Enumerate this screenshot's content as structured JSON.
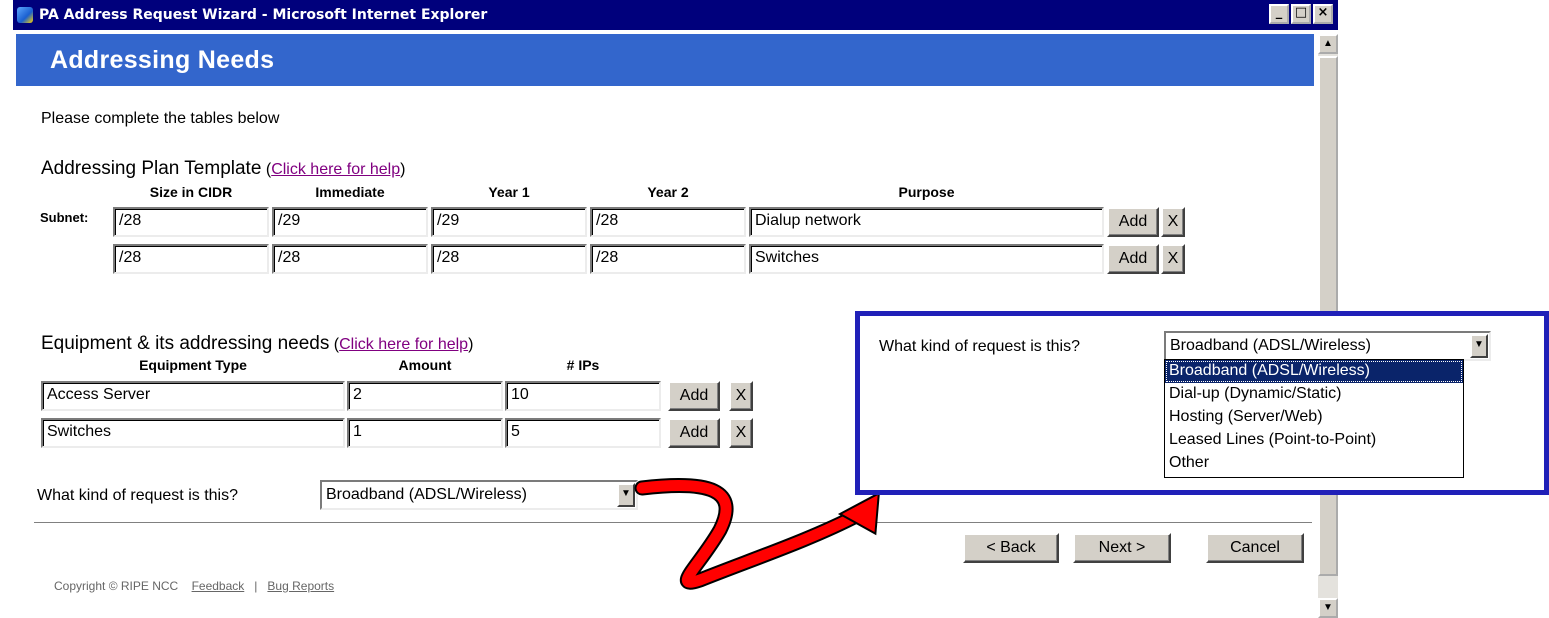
{
  "window": {
    "title": "PA Address Request Wizard - Microsoft Internet Explorer"
  },
  "page": {
    "heading": "Addressing Needs",
    "instruction": "Please complete the tables below"
  },
  "addressing_plan": {
    "title": "Addressing Plan Template",
    "help_link": "Click here for help",
    "row_label": "Subnet:",
    "columns": [
      "Size in CIDR",
      "Immediate",
      "Year 1",
      "Year 2",
      "Purpose"
    ],
    "rows": [
      {
        "size": "/28",
        "immediate": "/29",
        "year1": "/29",
        "year2": "/28",
        "purpose": "Dialup network"
      },
      {
        "size": "/28",
        "immediate": "/28",
        "year1": "/28",
        "year2": "/28",
        "purpose": "Switches"
      }
    ]
  },
  "equipment": {
    "title": "Equipment & its addressing needs",
    "help_link": "Click here for help",
    "columns": [
      "Equipment Type",
      "Amount",
      "# IPs"
    ],
    "rows": [
      {
        "type": "Access Server",
        "amount": "2",
        "ips": "10"
      },
      {
        "type": "Switches",
        "amount": "1",
        "ips": "5"
      }
    ]
  },
  "buttons": {
    "add": "Add",
    "remove": "X",
    "back": "< Back",
    "next": "Next >",
    "cancel": "Cancel"
  },
  "request": {
    "question": "What kind of request is this?",
    "selected": "Broadband (ADSL/Wireless)",
    "options": [
      "Broadband (ADSL/Wireless)",
      "Dial-up (Dynamic/Static)",
      "Hosting (Server/Web)",
      "Leased Lines (Point-to-Point)",
      "Other"
    ]
  },
  "footer": {
    "copyright": "Copyright © RIPE NCC",
    "feedback": "Feedback",
    "separator": "|",
    "bug_reports": "Bug Reports"
  },
  "colors": {
    "titlebar": "#00007c",
    "header": "#3366cc",
    "callout_border": "#2020b8",
    "arrow": "#ff0000",
    "selected": "#0a246a"
  }
}
